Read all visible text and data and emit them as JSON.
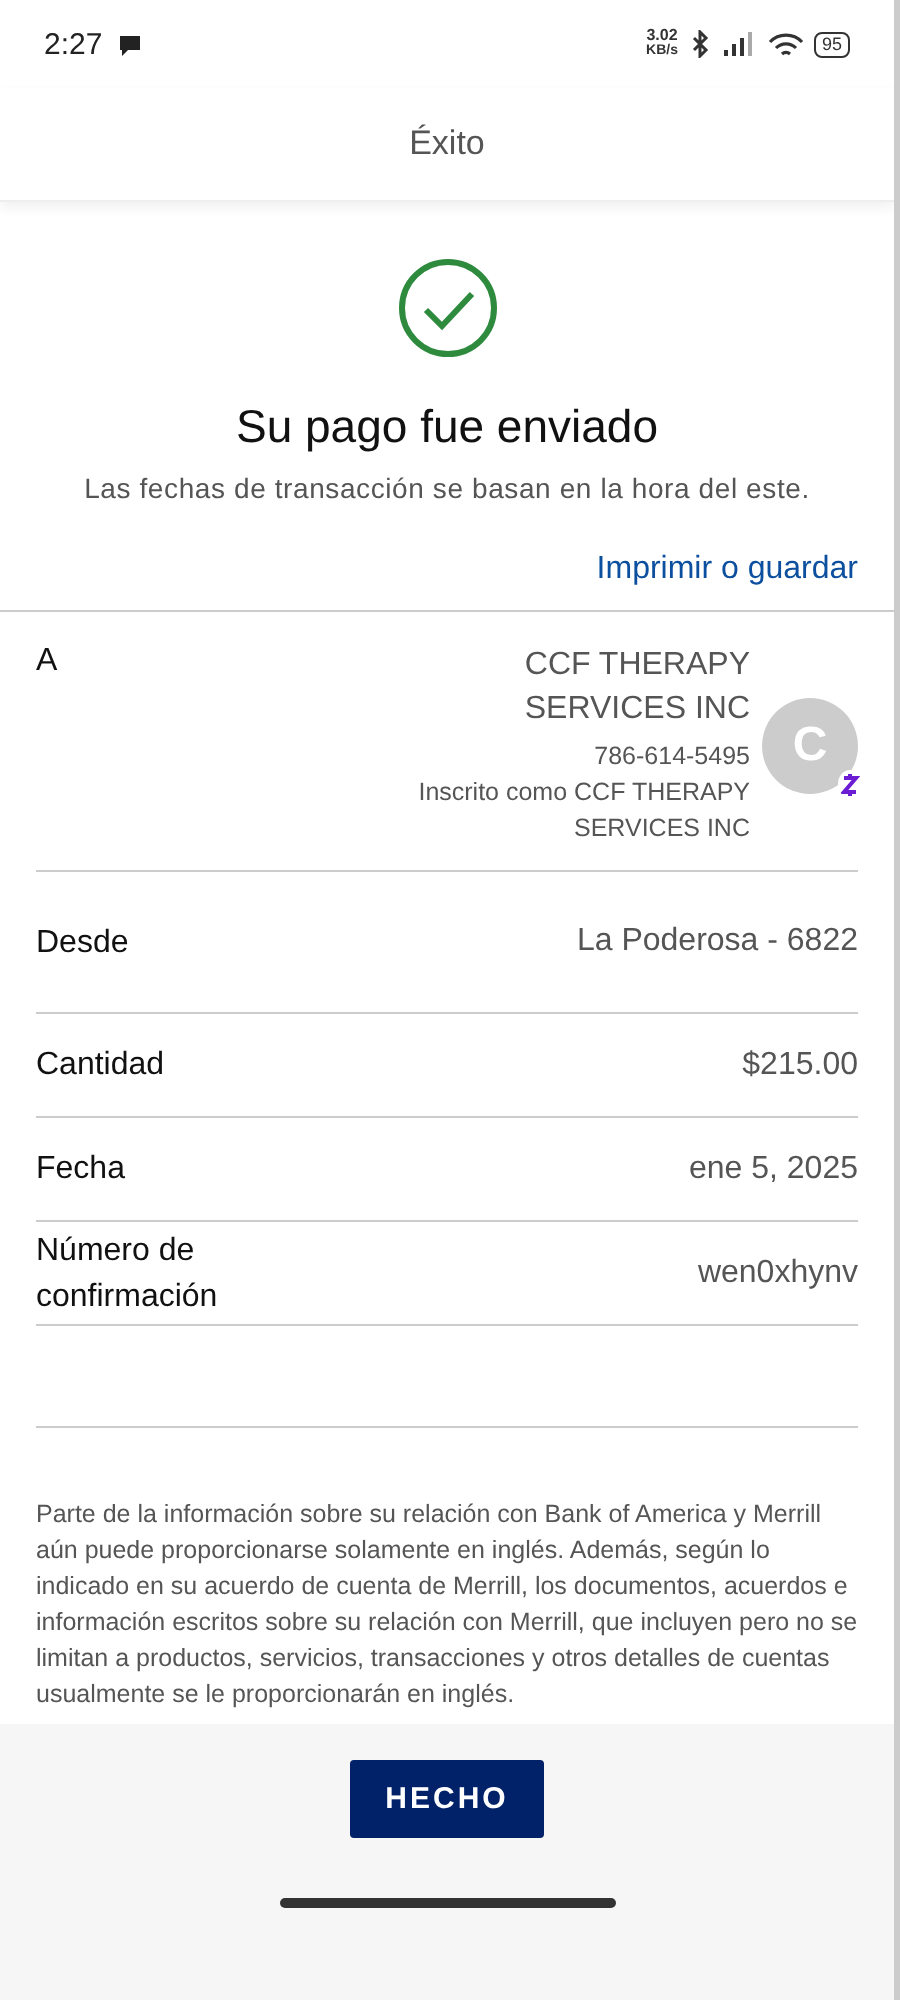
{
  "status_bar": {
    "time": "2:27",
    "speed_value": "3.02",
    "speed_unit": "KB/s",
    "battery": "95"
  },
  "header": {
    "title": "Éxito"
  },
  "confirmation": {
    "heading": "Su pago fue enviado",
    "note": "Las fechas de transacción se basan en la hora del este.",
    "link": "Imprimir o guardar"
  },
  "recipient": {
    "label": "A",
    "name": "CCF THERAPY SERVICES INC",
    "phone": "786-614-5495",
    "enrolled": "Inscrito como CCF THERAPY SERVICES INC",
    "avatar_letter": "C"
  },
  "details": [
    {
      "label": "Desde",
      "value": "La Poderosa - 6822"
    },
    {
      "label": "Cantidad",
      "value": "$215.00"
    },
    {
      "label": "Fecha",
      "value": "ene 5, 2025"
    },
    {
      "label": "Número de confirmación",
      "value": "wen0xhynv"
    }
  ],
  "disclaimer": "Parte de la información sobre su relación con Bank of America y Merrill aún puede proporcionarse solamente en inglés. Además, según lo indicado en su acuerdo de cuenta de Merrill, los documentos, acuerdos e información escritos sobre su relación con Merrill, que incluyen pero no se limitan a productos, servicios, transacciones y otros detalles de cuentas usualmente se le proporcionarán en inglés.",
  "done_button": "HECHO"
}
